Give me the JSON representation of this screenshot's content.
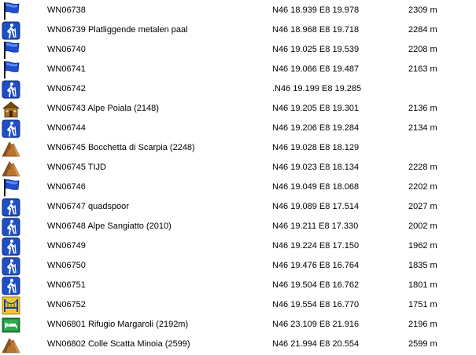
{
  "waypoints": [
    {
      "icon": "blue-flag-icon",
      "name": "WN06738",
      "position": "N46 18.939 E8 19.978",
      "altitude": "2309 m"
    },
    {
      "icon": "hiker-icon",
      "name": "WN06739 Platliggende metalen paal",
      "position": "N46 18.968 E8 19.718",
      "altitude": "2284 m"
    },
    {
      "icon": "blue-flag-icon",
      "name": "WN06740",
      "position": "N46 19.025 E8 19.539",
      "altitude": "2208 m"
    },
    {
      "icon": "blue-flag-icon",
      "name": "WN06741",
      "position": "N46 19.066 E8 19.487",
      "altitude": "2163 m"
    },
    {
      "icon": "hiker-icon",
      "name": "WN06742",
      "position": ".N46 19.199 E8 19.285",
      "altitude": ""
    },
    {
      "icon": "cabin-icon",
      "name": "WN06743 Alpe Poiala (2148)",
      "position": "N46 19.205 E8 19.301",
      "altitude": "2136 m"
    },
    {
      "icon": "hiker-icon",
      "name": "WN06744",
      "position": "N46 19.206 E8 19.284",
      "altitude": "2134 m"
    },
    {
      "icon": "summit-icon",
      "name": "WN06745 Bocchetta di Scarpia (2248)",
      "position": "N46 19.028 E8 18.129",
      "altitude": ""
    },
    {
      "icon": "summit-icon",
      "name": "WN06745 TIJD",
      "position": "N46 19.023 E8 18.134",
      "altitude": "2228 m"
    },
    {
      "icon": "blue-flag-icon",
      "name": "WN06746",
      "position": "N46 19.049 E8 18.068",
      "altitude": "2202 m"
    },
    {
      "icon": "hiker-icon",
      "name": "WN06747 quadspoor",
      "position": "N46 19.089 E8 17.514",
      "altitude": "2027 m"
    },
    {
      "icon": "hiker-icon",
      "name": "WN06748 Alpe Sangiatto (2010)",
      "position": "N46 19.211 E8 17.330",
      "altitude": "2002 m"
    },
    {
      "icon": "hiker-icon",
      "name": "WN06749",
      "position": "N46 19.224 E8 17.150",
      "altitude": "1962 m"
    },
    {
      "icon": "hiker-icon",
      "name": "WN06750",
      "position": "N46 19.476 E8 16.764",
      "altitude": "1835 m"
    },
    {
      "icon": "hiker-icon",
      "name": "WN06751",
      "position": "N46 19.504 E8 16.762",
      "altitude": "1801 m"
    },
    {
      "icon": "bridge-icon",
      "name": "WN06752",
      "position": "N46 19.554 E8 16.770",
      "altitude": "1751 m"
    },
    {
      "icon": "lodging-icon",
      "name": "WN06801 Rifugio Margaroli (2192m)",
      "position": "N46 23.109 E8 21.916",
      "altitude": "2196 m"
    },
    {
      "icon": "summit-icon",
      "name": "WN06802 Colle Scatta Minoia (2599)",
      "position": "N46 21.994 E8 20.554",
      "altitude": "2599 m"
    }
  ]
}
